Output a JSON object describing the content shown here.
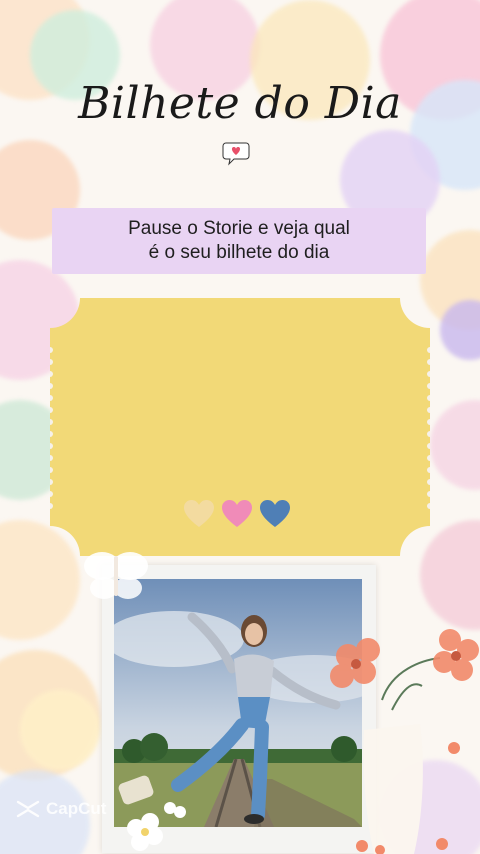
{
  "story": {
    "title": "Bilhete do Dia",
    "instruction_line1": "Pause o Storie e veja qual",
    "instruction_line2": "é o seu bilhete do dia",
    "ticket_color": "#f2d977",
    "instruction_bg": "#e9d4f3",
    "hearts": [
      {
        "name": "heart-faded-icon",
        "color": "#f3dba0"
      },
      {
        "name": "heart-pink-icon",
        "color": "#f08bb8"
      },
      {
        "name": "heart-blue-icon",
        "color": "#4f7fb6"
      }
    ]
  },
  "watermark": {
    "icon": "capcut-logo-icon",
    "text": "CapCut"
  }
}
